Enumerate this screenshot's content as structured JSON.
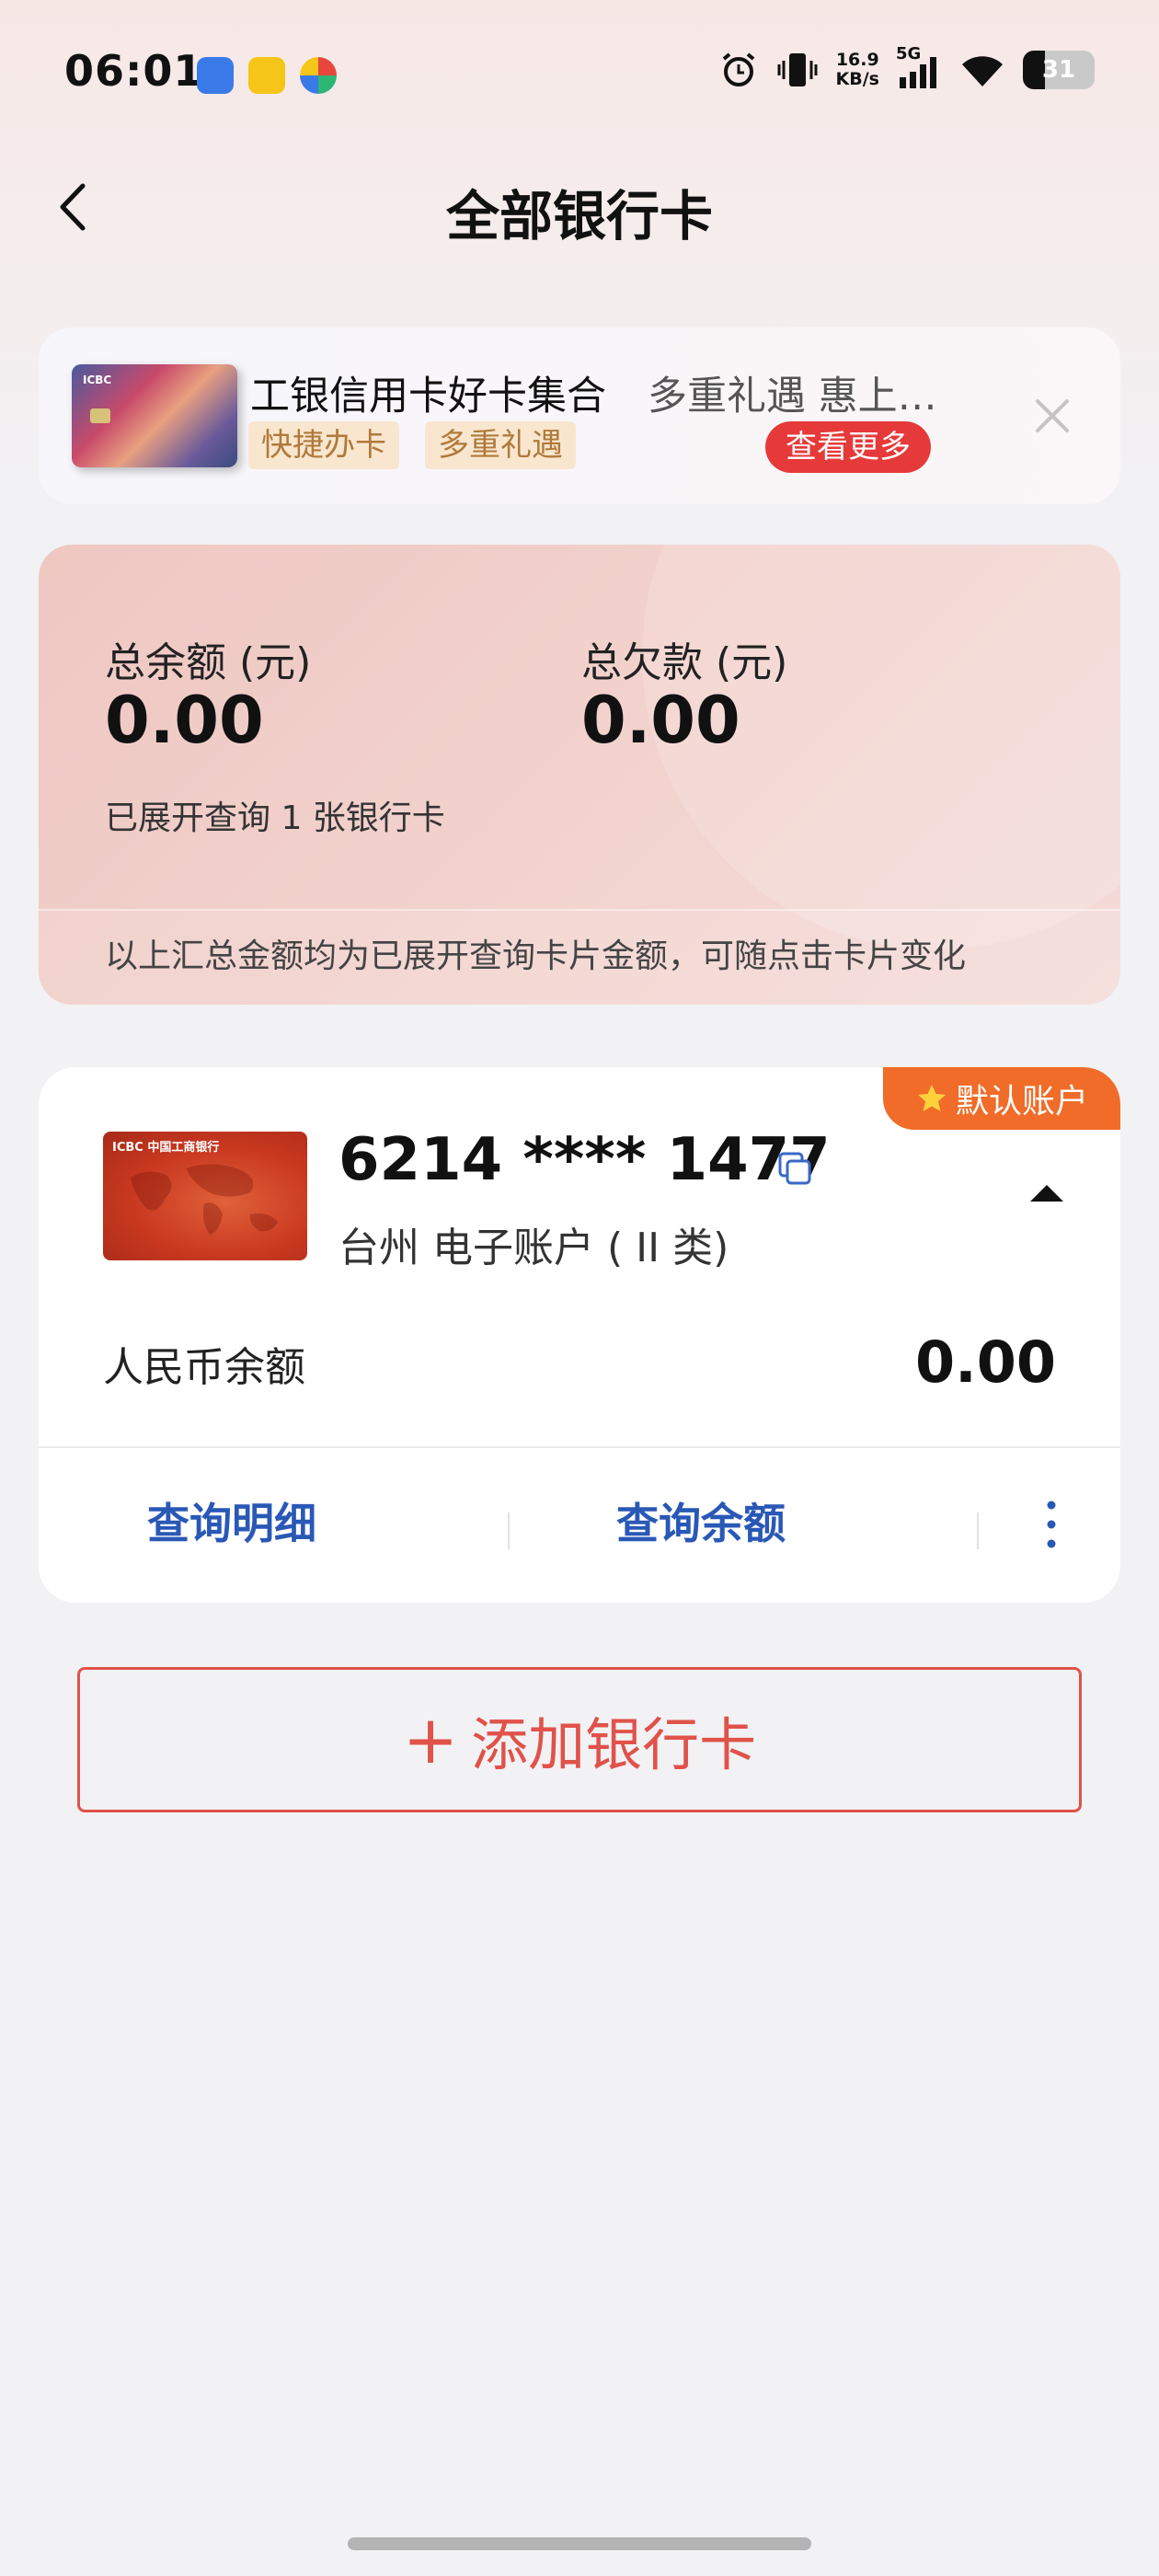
{
  "status_bar": {
    "time": "06:01",
    "net_speed_value": "16.9",
    "net_speed_unit": "KB/s",
    "network": "5G",
    "battery": "31"
  },
  "header": {
    "title": "全部银行卡"
  },
  "promo": {
    "title": "工银信用卡好卡集合",
    "subtitle": "多重礼遇 惠上…",
    "tags": [
      "快捷办卡",
      "多重礼遇"
    ],
    "more_button": "查看更多",
    "card_brand": "ICBC"
  },
  "summary": {
    "balance_label": "总余额 (元)",
    "balance_value": "0.00",
    "debt_label": "总欠款 (元)",
    "debt_value": "0.00",
    "note": "已展开查询 1 张银行卡",
    "footer": "以上汇总金额均为已展开查询卡片金额，可随点击卡片变化"
  },
  "account": {
    "default_badge": "默认账户",
    "card_brand": "ICBC 中国工商银行",
    "card_number": "6214 **** 1477",
    "card_subtitle": "台州 电子账户 ( II 类)",
    "rmb_label": "人民币余额",
    "rmb_value": "0.00",
    "actions": [
      "查询明细",
      "查询余额"
    ]
  },
  "add_card": {
    "label": "添加银行卡"
  },
  "colors": {
    "accent_red": "#e0524a",
    "badge_orange": "#f06c28",
    "link_blue": "#2a58b6",
    "promo_button": "#e63a3a"
  }
}
